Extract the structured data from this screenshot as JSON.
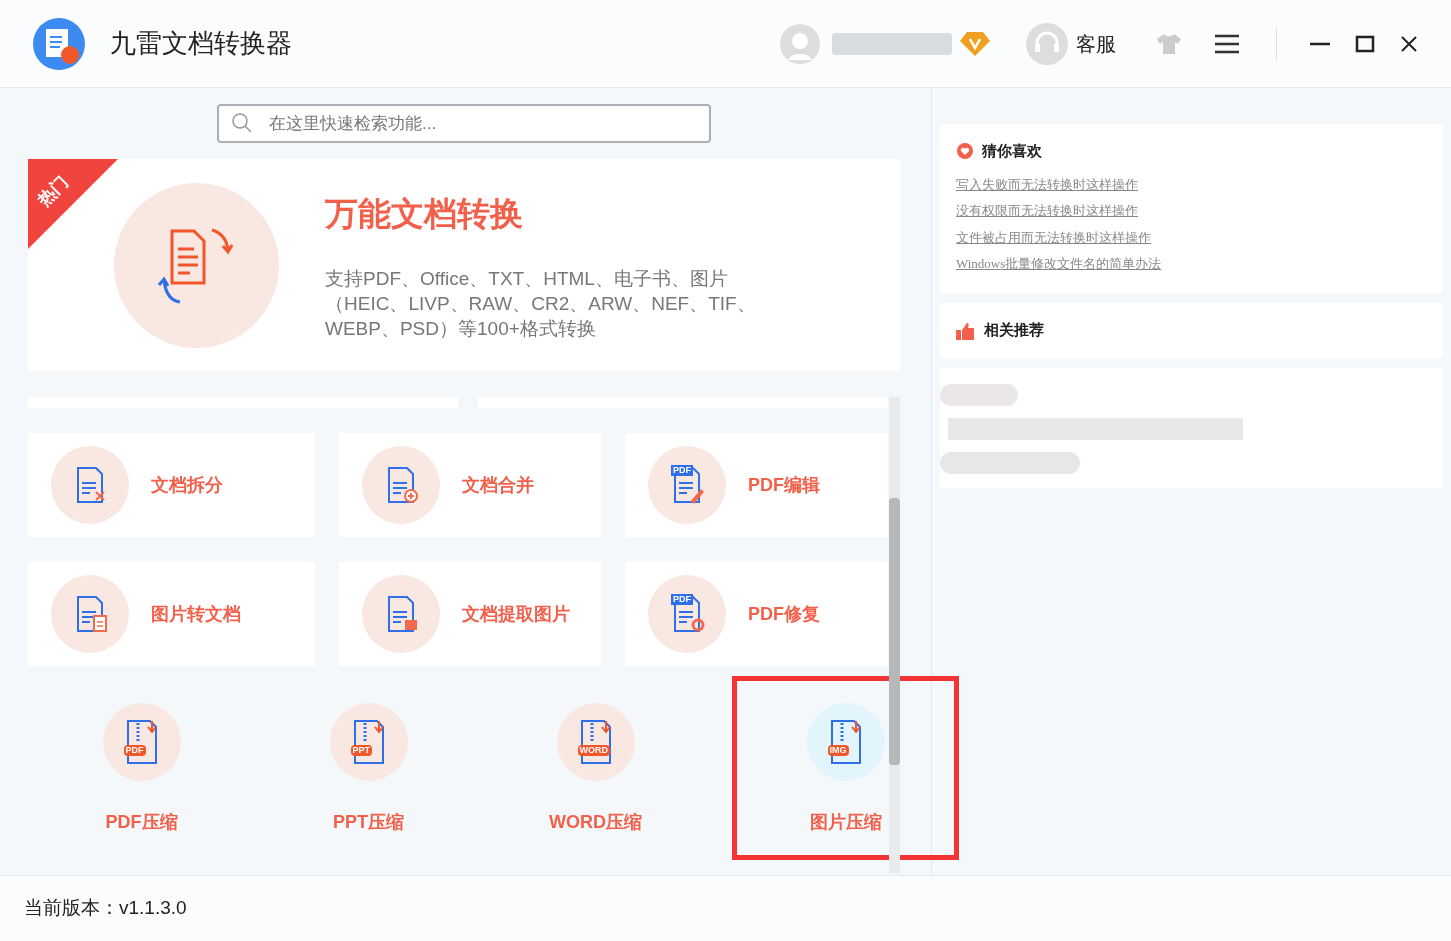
{
  "window": {
    "title": "九雷文档转换器"
  },
  "header": {
    "support": "客服"
  },
  "search": {
    "placeholder": "在这里快速检索功能..."
  },
  "hero": {
    "badge": "热门",
    "title": "万能文档转换",
    "description": "支持PDF、Office、TXT、HTML、电子书、图片（HEIC、LIVP、RAW、CR2、ARW、NEF、TIF、WEBP、PSD）等100+格式转换"
  },
  "tools": [
    {
      "label": "文档拆分",
      "kind": "split"
    },
    {
      "label": "文档合并",
      "kind": "merge"
    },
    {
      "label": "PDF编辑",
      "kind": "pdfedit",
      "icon_label": "PDF"
    },
    {
      "label": "图片转文档",
      "kind": "img2doc"
    },
    {
      "label": "文档提取图片",
      "kind": "extract"
    },
    {
      "label": "PDF修复",
      "kind": "pdfrepair",
      "icon_label": "PDF"
    }
  ],
  "compress": [
    {
      "label": "PDF压缩",
      "icon_label": "PDF",
      "selected": false
    },
    {
      "label": "PPT压缩",
      "icon_label": "PPT",
      "selected": false
    },
    {
      "label": "WORD压缩",
      "icon_label": "WORD",
      "selected": false
    },
    {
      "label": "图片压缩",
      "icon_label": "IMG",
      "selected": true
    }
  ],
  "sidebar": {
    "favorites_title": "猜你喜欢",
    "links": [
      "写入失败而无法转换时这样操作",
      "没有权限而无法转换时这样操作",
      "文件被占用而无法转换时这样操作",
      "Windows批量修改文件名的简单办法"
    ],
    "recommend_title": "相关推荐"
  },
  "status_bar": {
    "version": "当前版本：v1.1.3.0"
  }
}
